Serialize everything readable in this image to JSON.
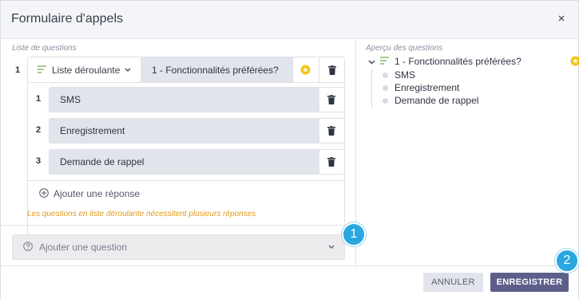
{
  "dialog": {
    "title": "Formulaire d'appels",
    "close_icon": "close-icon"
  },
  "questions_section": {
    "label": "Liste de questions",
    "question": {
      "index": "1",
      "type_label": "Liste déroulante",
      "title": "1 - Fonctionnalités préférées?",
      "answers": [
        {
          "index": "1",
          "value": "SMS"
        },
        {
          "index": "2",
          "value": "Enregistrement"
        },
        {
          "index": "3",
          "value": "Demande de rappel"
        }
      ],
      "add_answer_label": "Ajouter une réponse"
    },
    "warning": "Les questions en liste déroulante nécessitent plusieurs réponses",
    "add_question_placeholder": "Ajouter une question"
  },
  "preview_section": {
    "label": "Aperçu des questions",
    "question_title": "1 - Fonctionnalités préférées?",
    "items": [
      "SMS",
      "Enregistrement",
      "Demande de rappel"
    ]
  },
  "badges": [
    "1",
    "2"
  ],
  "footer": {
    "cancel_label": "ANNULER",
    "save_label": "ENREGISTRER"
  },
  "colors": {
    "accent": "#5d5f8a",
    "badge": "#29a7e1",
    "warning": "#e39a1b",
    "star": "#f5c518"
  }
}
